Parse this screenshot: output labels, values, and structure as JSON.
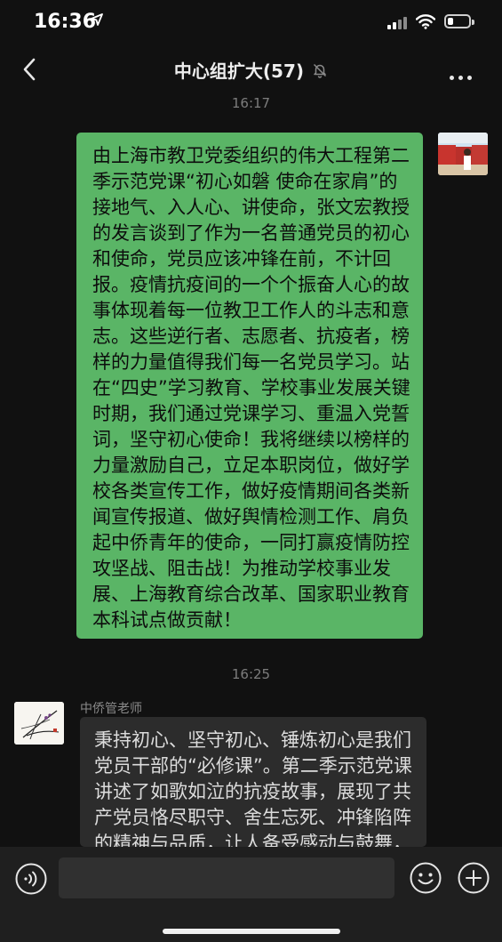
{
  "status_bar": {
    "time": "16:36"
  },
  "nav": {
    "title": "中心组扩大(57)"
  },
  "messages": {
    "timestamp_1": "16:17",
    "self_text": "由上海市教卫党委组织的伟大工程第二季示范党课“初心如磐 使命在家肩”的接地气、入人心、讲使命，张文宏教授的发言谈到了作为一名普通党员的初心和使命，党员应该冲锋在前，不计回报。疫情抗疫间的一个个振奋人心的故事体现着每一位教卫工作人的斗志和意志。这些逆行者、志愿者、抗疫者，榜样的力量值得我们每一名党员学习。站在“四史”学习教育、学校事业发展关键时期，我们通过党课学习、重温入党誓词，坚守初心使命！我将继续以榜样的力量激励自己，立足本职岗位，做好学校各类宣传工作，做好疫情期间各类新闻宣传报道、做好舆情检测工作、肩负起中侨青年的使命，一同打赢疫情防控攻坚战、阻击战！为推动学校事业发展、上海教育综合改革、国家职业教育本科试点做贡献！",
    "timestamp_2": "16:25",
    "other_sender": "中侨管老师",
    "other_text": "秉持初心、坚守初心、锤炼初心是我们党员干部的“必修课”。第二季示范党课讲述了如歌如泣的抗疫故事，展现了共产党员恪尽职守、舍生忘死、冲锋陷阵的精神与品质，让人备受感动与鼓舞，我相信示范"
  },
  "input": {
    "value": ""
  },
  "icons": {
    "back": "chevron-left-icon",
    "mute": "bell-slash-icon",
    "more": "ellipsis-icon",
    "voice": "voice-icon",
    "emoji": "smiley-icon",
    "plus": "plus-circle-icon"
  },
  "colors": {
    "background": "#111111",
    "self_bubble": "#5ab566",
    "other_bubble": "#2c2c2c",
    "input_bar": "#1f1f1f"
  }
}
